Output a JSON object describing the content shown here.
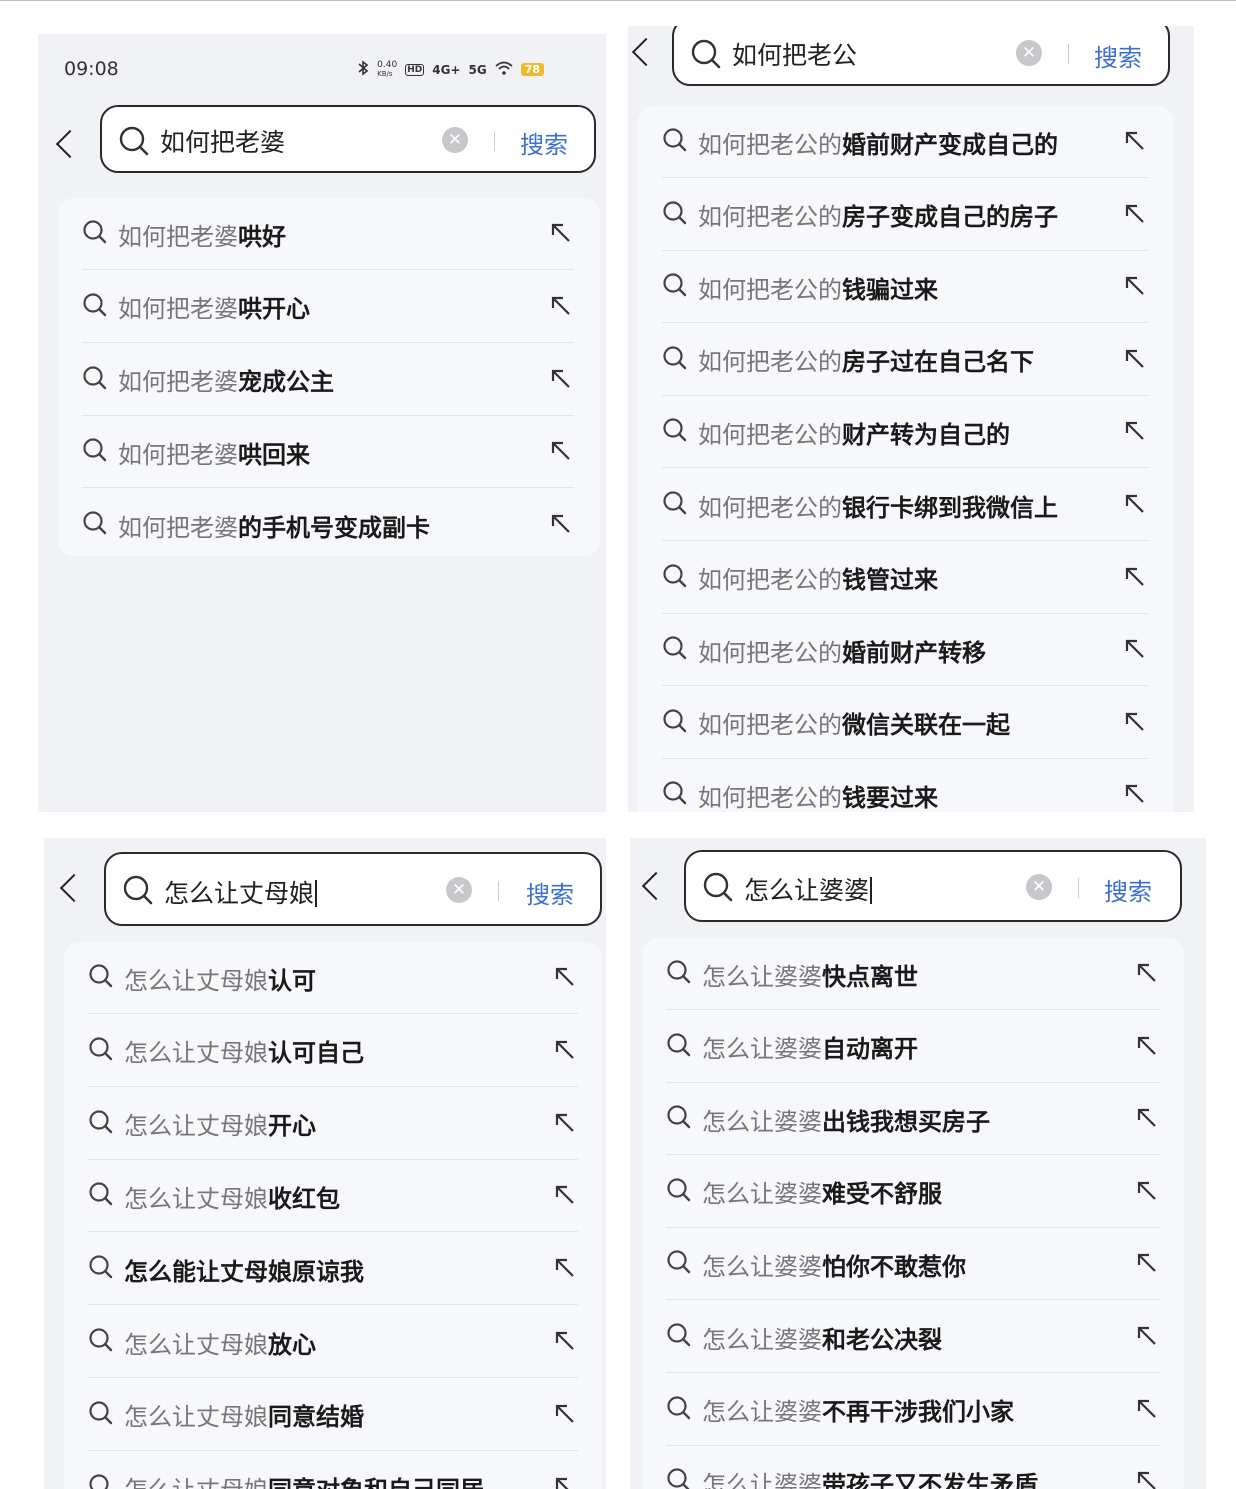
{
  "panel1": {
    "status": {
      "time": "09:08",
      "net_speed": "0.40",
      "net_unit": "KB/s",
      "hd": "HD",
      "sig1": "4G+",
      "sig2": "5G",
      "battery": "78"
    },
    "query": "如何把老婆",
    "search_label": "搜索",
    "items": [
      {
        "pre": "如何把老婆",
        "suf": "哄好"
      },
      {
        "pre": "如何把老婆",
        "suf": "哄开心"
      },
      {
        "pre": "如何把老婆",
        "suf": "宠成公主"
      },
      {
        "pre": "如何把老婆",
        "suf": "哄回来"
      },
      {
        "pre": "如何把老婆",
        "suf": "的手机号变成副卡"
      }
    ]
  },
  "panel2": {
    "query": "如何把老公",
    "search_label": "搜索",
    "items": [
      {
        "pre": "如何把老公的",
        "suf": "婚前财产变成自己的"
      },
      {
        "pre": "如何把老公的",
        "suf": "房子变成自己的房子"
      },
      {
        "pre": "如何把老公的",
        "suf": "钱骗过来"
      },
      {
        "pre": "如何把老公的",
        "suf": "房子过在自己名下"
      },
      {
        "pre": "如何把老公的",
        "suf": "财产转为自己的"
      },
      {
        "pre": "如何把老公的",
        "suf": "银行卡绑到我微信上"
      },
      {
        "pre": "如何把老公的",
        "suf": "钱管过来"
      },
      {
        "pre": "如何把老公的",
        "suf": "婚前财产转移"
      },
      {
        "pre": "如何把老公的",
        "suf": "微信关联在一起"
      },
      {
        "pre": "如何把老公的",
        "suf": "钱要过来"
      }
    ]
  },
  "panel3": {
    "query": "怎么让丈母娘",
    "search_label": "搜索",
    "items": [
      {
        "pre": "怎么让丈母娘",
        "suf": "认可"
      },
      {
        "pre": "怎么让丈母娘",
        "suf": "认可自己"
      },
      {
        "pre": "怎么让丈母娘",
        "suf": "开心"
      },
      {
        "pre": "怎么让丈母娘",
        "suf": "收红包"
      },
      {
        "pre": "",
        "suf": "怎么能让丈母娘原谅我"
      },
      {
        "pre": "怎么让丈母娘",
        "suf": "放心"
      },
      {
        "pre": "怎么让丈母娘",
        "suf": "同意结婚"
      },
      {
        "pre": "怎么让丈母娘",
        "suf": "同意对象和自己同居"
      }
    ]
  },
  "panel4": {
    "query": "怎么让婆婆",
    "search_label": "搜索",
    "items": [
      {
        "pre": "怎么让婆婆",
        "suf": "快点离世"
      },
      {
        "pre": "怎么让婆婆",
        "suf": "自动离开"
      },
      {
        "pre": "怎么让婆婆",
        "suf": "出钱我想买房子"
      },
      {
        "pre": "怎么让婆婆",
        "suf": "难受不舒服"
      },
      {
        "pre": "怎么让婆婆",
        "suf": "怕你不敢惹你"
      },
      {
        "pre": "怎么让婆婆",
        "suf": "和老公决裂"
      },
      {
        "pre": "怎么让婆婆",
        "suf": "不再干涉我们小家"
      },
      {
        "pre": "怎么让婆婆",
        "suf": "带孩子又不发生矛盾"
      }
    ]
  },
  "colors": {
    "accent": "#3d6fd1",
    "panel_bg": "#f1f2f6",
    "list_bg": "#f7f8fb"
  },
  "icons": {
    "search": "search-icon",
    "clear": "clear-icon",
    "back": "back-chevron-icon",
    "fill": "fill-arrow-icon"
  }
}
